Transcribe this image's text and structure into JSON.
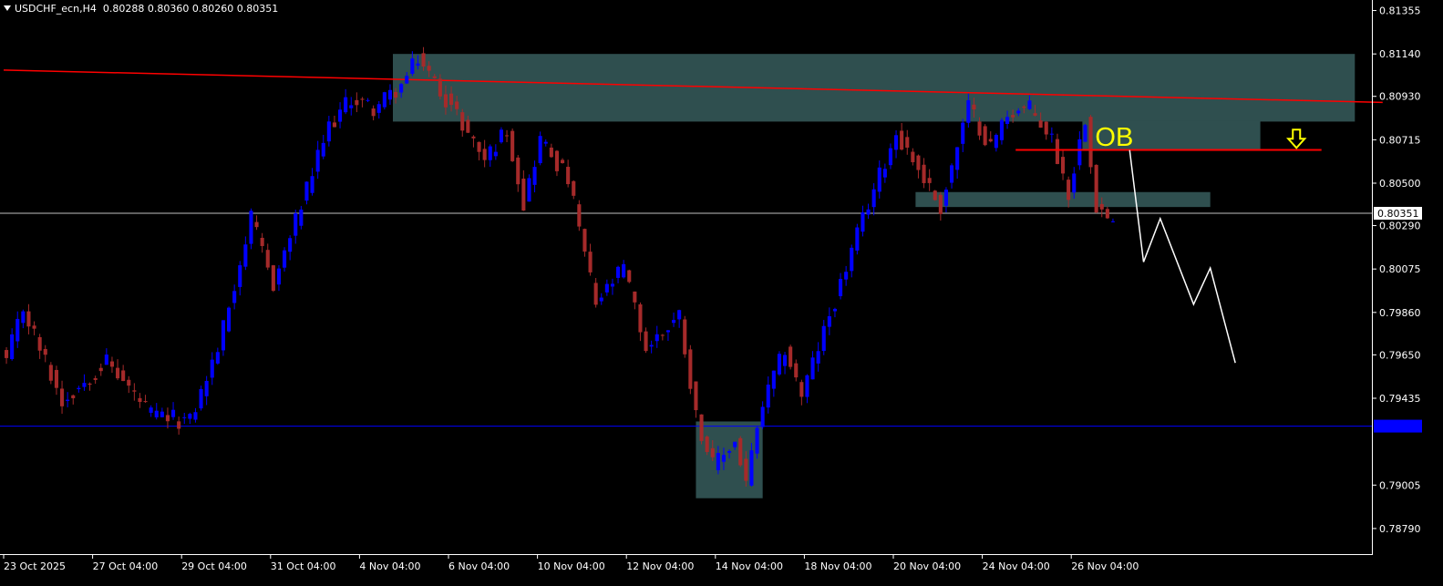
{
  "header": {
    "symbol_timeframe": "USDCHF_ecn,H4",
    "ohlc": "0.80288 0.80360 0.80260 0.80351"
  },
  "colors": {
    "background": "#000000",
    "bull": "#0000ff",
    "bear": "#a52a2a",
    "zone": "#2f4f4f",
    "trendline": "#ff0000",
    "support_line": "#0000ff",
    "price_line": "#c0c0c0",
    "projection": "#ffffff",
    "ob_label": "#ffff00",
    "axis_text": "#ffffff"
  },
  "chart_data": {
    "type": "candlestick",
    "symbol": "USDCHF_ecn",
    "timeframe": "H4",
    "y_range": [
      0.7874,
      0.8138
    ],
    "y_ticks": [
      "0.81355",
      "0.81140",
      "0.80930",
      "0.80715",
      "0.80500",
      "0.80290",
      "0.80075",
      "0.79860",
      "0.79650",
      "0.79435",
      "0.79005",
      "0.78790"
    ],
    "x_labels": [
      {
        "bar": 0,
        "label": "23 Oct 2025"
      },
      {
        "bar": 16,
        "label": "27 Oct 04:00"
      },
      {
        "bar": 32,
        "label": "29 Oct 04:00"
      },
      {
        "bar": 48,
        "label": "31 Oct 04:00"
      },
      {
        "bar": 64,
        "label": "4 Nov 04:00"
      },
      {
        "bar": 80,
        "label": "6 Nov 04:00"
      },
      {
        "bar": 96,
        "label": "10 Nov 04:00"
      },
      {
        "bar": 112,
        "label": "12 Nov 04:00"
      },
      {
        "bar": 128,
        "label": "14 Nov 04:00"
      },
      {
        "bar": 144,
        "label": "18 Nov 04:00"
      },
      {
        "bar": 160,
        "label": "20 Nov 04:00"
      },
      {
        "bar": 176,
        "label": "24 Nov 04:00"
      },
      {
        "bar": 192,
        "label": "26 Nov 04:00"
      }
    ],
    "current_price": "0.80351",
    "support_price": 0.79297,
    "support_label": "",
    "pivots": [
      [
        0,
        0.7962
      ],
      [
        3,
        0.7988
      ],
      [
        10,
        0.7942
      ],
      [
        18,
        0.7962
      ],
      [
        26,
        0.7935
      ],
      [
        33,
        0.7932
      ],
      [
        38,
        0.7968
      ],
      [
        44,
        0.8032
      ],
      [
        48,
        0.8
      ],
      [
        58,
        0.8078
      ],
      [
        62,
        0.8092
      ],
      [
        66,
        0.8087
      ],
      [
        71,
        0.8098
      ],
      [
        74,
        0.8112
      ],
      [
        80,
        0.8088
      ],
      [
        86,
        0.8062
      ],
      [
        90,
        0.8077
      ],
      [
        93,
        0.804
      ],
      [
        96,
        0.8072
      ],
      [
        101,
        0.8052
      ],
      [
        106,
        0.799
      ],
      [
        111,
        0.8008
      ],
      [
        115,
        0.7968
      ],
      [
        121,
        0.7985
      ],
      [
        124,
        0.7935
      ],
      [
        127,
        0.791
      ],
      [
        131,
        0.7922
      ],
      [
        133,
        0.7902
      ],
      [
        136,
        0.794
      ],
      [
        140,
        0.7968
      ],
      [
        143,
        0.7945
      ],
      [
        150,
        0.8
      ],
      [
        155,
        0.804
      ],
      [
        160,
        0.8075
      ],
      [
        163,
        0.8062
      ],
      [
        168,
        0.8038
      ],
      [
        173,
        0.8088
      ],
      [
        177,
        0.8068
      ],
      [
        180,
        0.8085
      ],
      [
        184,
        0.8087
      ],
      [
        188,
        0.8072
      ],
      [
        191,
        0.8045
      ],
      [
        194,
        0.8083
      ],
      [
        196,
        0.804
      ],
      [
        199,
        0.8029
      ]
    ],
    "zones": [
      {
        "from_bar": 70,
        "to_bar": 243,
        "top": 0.8114,
        "bottom": 0.80805,
        "label": ""
      },
      {
        "from_bar": 124.5,
        "to_bar": 136.5,
        "top": 0.7932,
        "bottom": 0.7894,
        "label": ""
      },
      {
        "from_bar": 164,
        "to_bar": 217,
        "top": 0.80456,
        "bottom": 0.80382,
        "label": ""
      },
      {
        "from_bar": 194,
        "to_bar": 226,
        "top": 0.8081,
        "bottom": 0.8066,
        "label": "OB"
      }
    ],
    "trendline": {
      "bar1": 0,
      "price1": 0.8106,
      "bar2": 248,
      "price2": 0.809
    },
    "ob_level": {
      "from_bar": 182,
      "to_bar": 237,
      "price": 0.80665
    },
    "arrow_down": {
      "bar": 232.5,
      "price": 0.8072
    },
    "projection": [
      [
        202.5,
        0.80664
      ],
      [
        205,
        0.8011
      ],
      [
        208,
        0.80325
      ],
      [
        214,
        0.799
      ],
      [
        217,
        0.8008
      ],
      [
        221.5,
        0.7961
      ]
    ],
    "grid": false
  }
}
